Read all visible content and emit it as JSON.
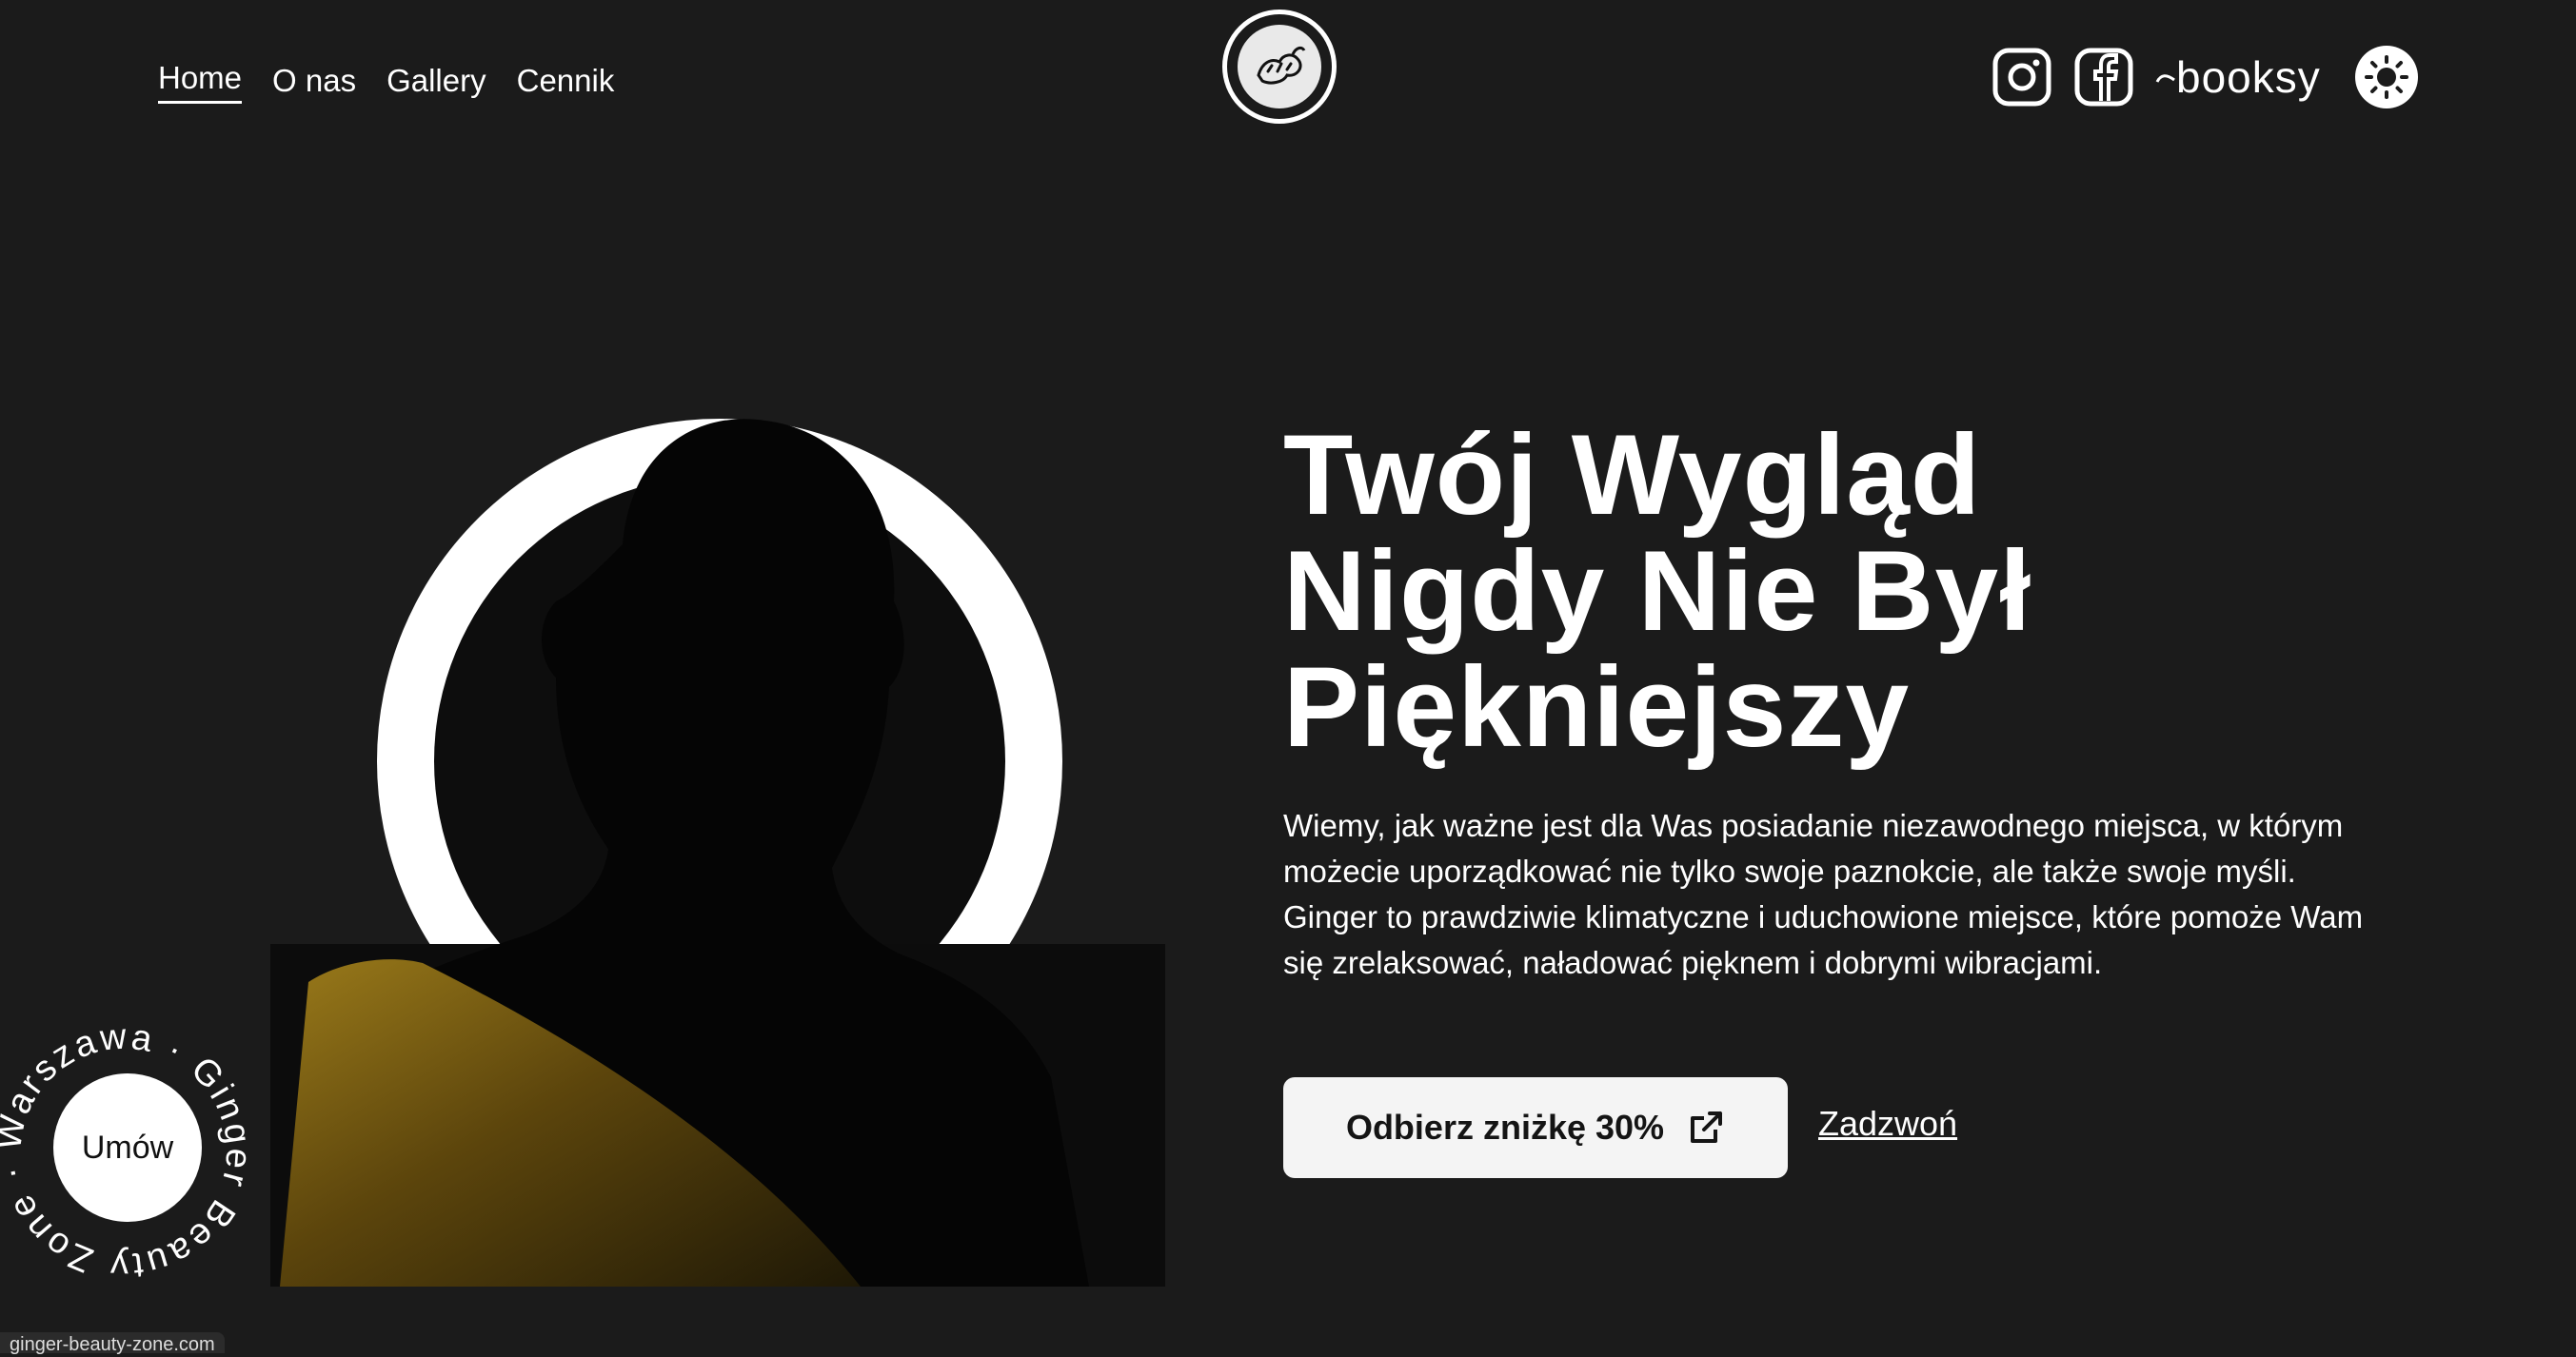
{
  "nav": {
    "items": [
      {
        "label": "Home",
        "active": true
      },
      {
        "label": "O nas"
      },
      {
        "label": "Gallery"
      },
      {
        "label": "Cennik"
      }
    ]
  },
  "header": {
    "logo_icon": "ginger-root-icon",
    "social": {
      "instagram_icon": "instagram-icon",
      "facebook_icon": "facebook-icon",
      "booksy_label": "booksy"
    },
    "theme_toggle_icon": "sun-icon"
  },
  "hero": {
    "title": "Twój Wygląd Nigdy Nie Był Piękniejszy",
    "text": "Wiemy, jak ważne jest dla Was posiadanie niezawodnego miejsca, w którym możecie uporządkować nie tylko swoje paznokcie, ale także swoje myśli. Ginger to prawdziwie klimatyczne i uduchowione miejsce, które pomoże Wam się zrelaksować, naładować pięknem i dobrymi wibracjami.",
    "cta_label": "Odbierz zniżkę 30%",
    "cta_icon": "external-link-icon",
    "call_label": "Zadzwoń"
  },
  "badge": {
    "ring_text": "Warszawa · Ginger Beauty Zone ·",
    "button_label": "Umów"
  },
  "status_bar": {
    "url": "ginger-beauty-zone.com"
  },
  "colors": {
    "background": "#1b1b1b",
    "foreground": "#ffffff",
    "accent_fabric": "#8a6a14"
  }
}
